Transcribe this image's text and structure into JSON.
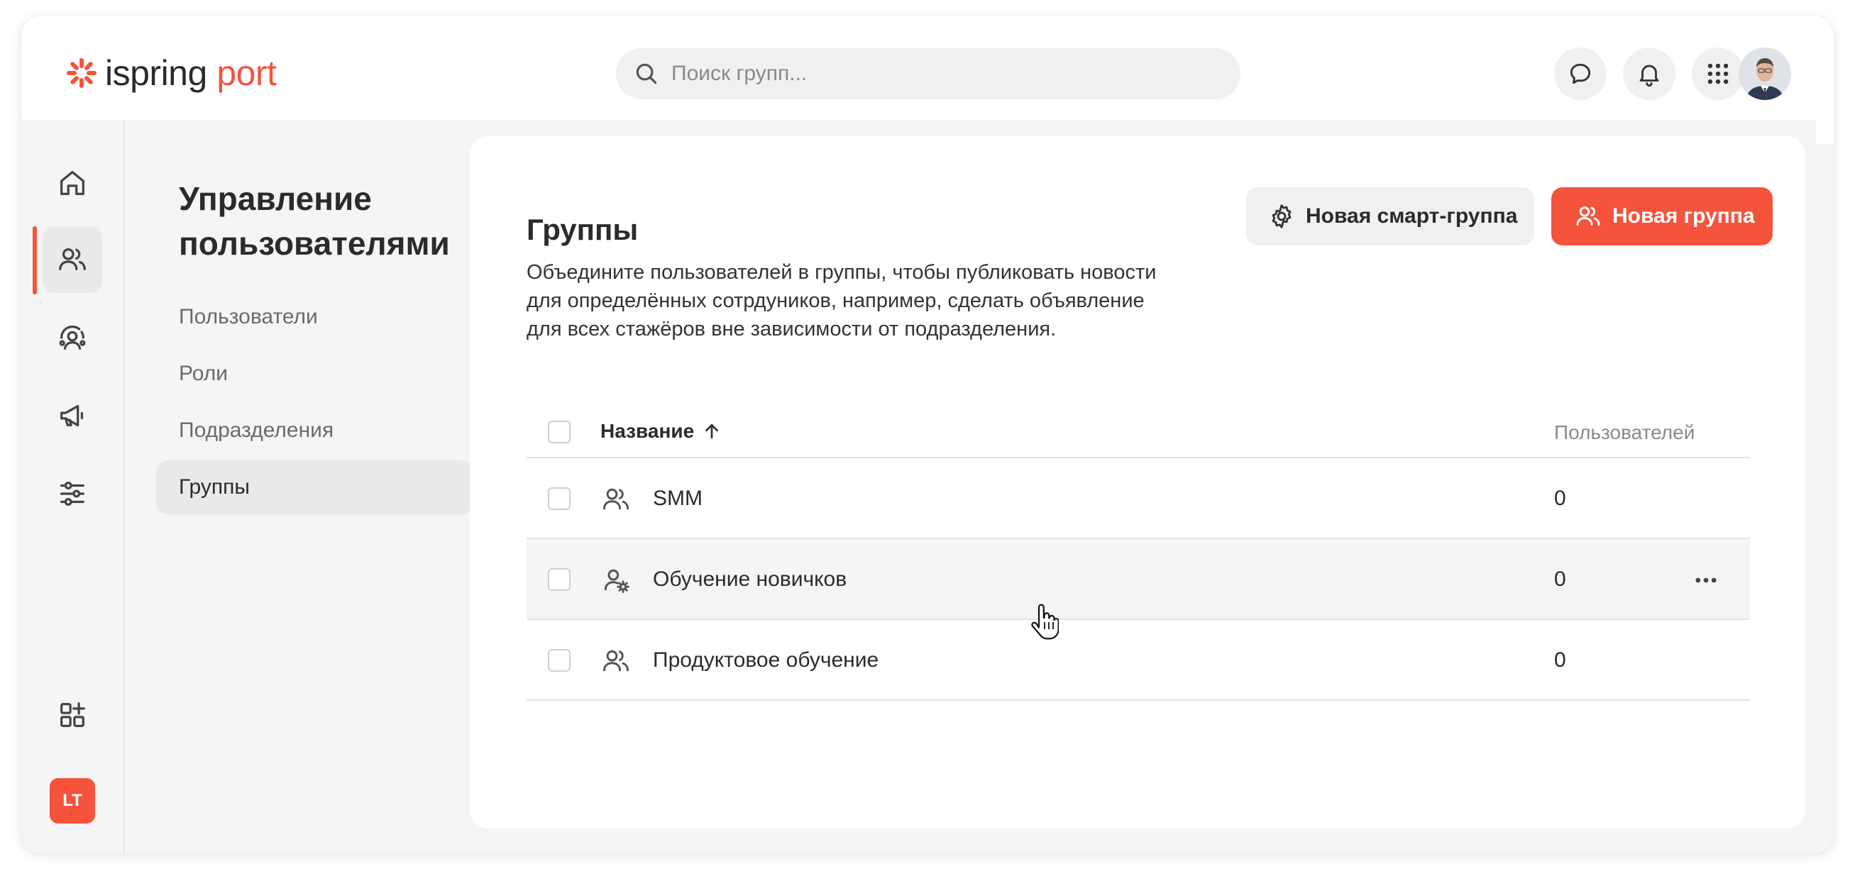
{
  "header": {
    "logo": {
      "brand": "ispring",
      "product": "port"
    },
    "search": {
      "placeholder": "Поиск групп...",
      "value": ""
    },
    "icons": [
      "chat-icon",
      "bell-icon",
      "apps-grid-icon"
    ],
    "accent_color": "#f5533c"
  },
  "rail": {
    "items": [
      "home-icon",
      "users-icon",
      "team-settings-icon",
      "megaphone-icon",
      "sliders-icon"
    ],
    "bottom": [
      "add-widget-icon"
    ],
    "badge": "LT",
    "active_index": 1
  },
  "subnav": {
    "title": "Управление пользователями",
    "items": [
      {
        "label": "Пользователи"
      },
      {
        "label": "Роли"
      },
      {
        "label": "Подразделения"
      },
      {
        "label": "Группы"
      }
    ],
    "active_index": 3
  },
  "main": {
    "title": "Группы",
    "description": "Объедините пользователей в группы, чтобы публиковать новости для определённых сотрдуников, например, сделать объявление для всех стажёров вне зависимости от подразделения.",
    "buttons": {
      "smart_group": "Новая смарт-группа",
      "new_group": "Новая группа"
    },
    "table": {
      "columns": {
        "name": "Название",
        "users": "Пользователей"
      },
      "sort": "name-ascending",
      "rows": [
        {
          "name": "SMM",
          "users": "0",
          "icon": "group-icon"
        },
        {
          "name": "Обучение новичков",
          "users": "0",
          "icon": "smart-group-icon"
        },
        {
          "name": "Продуктовое обучение",
          "users": "0",
          "icon": "group-icon"
        }
      ]
    }
  }
}
